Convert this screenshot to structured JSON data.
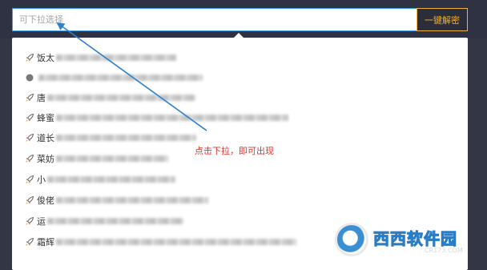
{
  "search": {
    "placeholder": "可下拉选择"
  },
  "toolbar": {
    "decrypt_label": "一键解密"
  },
  "dropdown": {
    "items": [
      {
        "label": "饭太",
        "icon": "rocket-icon"
      },
      {
        "label": "",
        "icon": "rocket-icon"
      },
      {
        "label": "唐",
        "icon": "rocket-icon"
      },
      {
        "label": "蜂蜜",
        "icon": "rocket-icon"
      },
      {
        "label": "道长",
        "icon": "rocket-icon"
      },
      {
        "label": "菜妨",
        "icon": "rocket-icon"
      },
      {
        "label": "小",
        "icon": "rocket-icon"
      },
      {
        "label": "俊佬",
        "icon": "rocket-icon"
      },
      {
        "label": "运",
        "icon": "rocket-icon"
      },
      {
        "label": "霜辉",
        "icon": "rocket-icon"
      }
    ]
  },
  "annotation": {
    "text": "点击下拉，即可出现",
    "color": "#e0322a"
  },
  "watermark": {
    "title": "西西软件园",
    "url": "CR173.COM"
  },
  "colors": {
    "accent": "#3aa0e6",
    "button_text": "#f0b233",
    "background": "#333645"
  }
}
